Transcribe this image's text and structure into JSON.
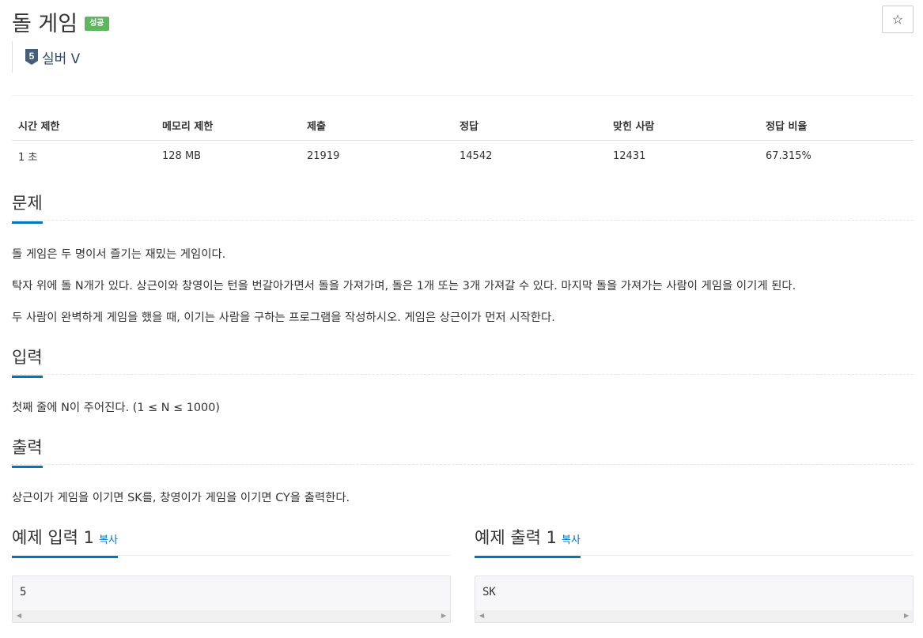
{
  "header": {
    "title": "돌 게임",
    "result_badge": "성공",
    "star_icon": "☆",
    "tier_number": "5",
    "tier_label": "실버 V"
  },
  "stats": {
    "headers": [
      "시간 제한",
      "메모리 제한",
      "제출",
      "정답",
      "맞힌 사람",
      "정답 비율"
    ],
    "values": [
      "1 초",
      "128 MB",
      "21919",
      "14542",
      "12431",
      "67.315%"
    ]
  },
  "problem": {
    "heading": "문제",
    "paragraphs": [
      "돌 게임은 두 명이서 즐기는 재밌는 게임이다.",
      "탁자 위에 돌 N개가 있다. 상근이와 창영이는 턴을 번갈아가면서 돌을 가져가며, 돌은 1개 또는 3개 가져갈 수 있다. 마지막 돌을 가져가는 사람이 게임을 이기게 된다.",
      "두 사람이 완벽하게 게임을 했을 때, 이기는 사람을 구하는 프로그램을 작성하시오. 게임은 상근이가 먼저 시작한다."
    ]
  },
  "input": {
    "heading": "입력",
    "text": "첫째 줄에 N이 주어진다. (1 ≤ N ≤ 1000)"
  },
  "output": {
    "heading": "출력",
    "text": "상근이가 게임을 이기면 SK를, 창영이가 게임을 이기면 CY을 출력한다."
  },
  "samples": {
    "input_heading": "예제 입력 1",
    "output_heading": "예제 출력 1",
    "copy_label": "복사",
    "input_value": "5",
    "output_value": "SK"
  },
  "colors": {
    "accent": "#0076c0",
    "success": "#5cb85c",
    "tier": "#435f7a"
  }
}
